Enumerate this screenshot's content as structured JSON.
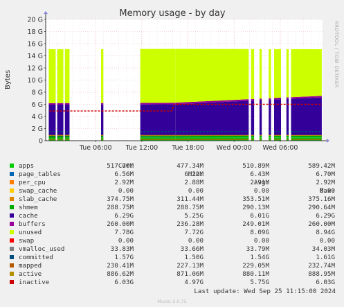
{
  "chart_data": {
    "type": "area",
    "title": "Memory usage - by day",
    "ylabel": "Bytes",
    "side_label": "RRDTOOL / TOBI OETIKER",
    "y_ticks": [
      "0",
      "2 G",
      "4 G",
      "6 G",
      "8 G",
      "10 G",
      "12 G",
      "14 G",
      "16 G",
      "18 G",
      "20 G"
    ],
    "ylim": [
      0,
      20
    ],
    "y_unit": "GiB",
    "x_ticks": [
      {
        "label": "Tue 06:00",
        "t": 6
      },
      {
        "label": "Tue 12:00",
        "t": 12
      },
      {
        "label": "Tue 18:00",
        "t": 18
      },
      {
        "label": "Wed 00:00",
        "t": 24
      },
      {
        "label": "Wed 06:00",
        "t": 30
      }
    ],
    "x_range_hours": [
      -0.5,
      35.5
    ],
    "grid": true,
    "online_intervals": [
      [
        -0.1,
        0.8
      ],
      [
        1.0,
        1.8
      ],
      [
        2.0,
        2.6
      ],
      [
        6.7,
        7.0
      ],
      [
        11.8,
        16.4
      ],
      [
        16.4,
        25.9
      ],
      [
        26.2,
        26.6
      ],
      [
        27.3,
        27.6
      ],
      [
        28.5,
        28.8
      ],
      [
        29.2,
        30.1
      ],
      [
        30.8,
        31.1
      ],
      [
        31.4,
        35.4
      ]
    ],
    "stack_levels": [
      {
        "name": "apps",
        "color": "#00cc00",
        "values": [
          0.45,
          0.5,
          0.55
        ],
        "t": [
          0,
          16,
          35
        ]
      },
      {
        "name": "page_tables",
        "color": "#0066b3",
        "values": [
          0.01,
          0.01,
          0.01
        ],
        "t": [
          0,
          16,
          35
        ]
      },
      {
        "name": "shmem",
        "color": "#00aa00",
        "values": [
          0.28,
          0.28,
          0.28
        ],
        "t": [
          0,
          16,
          35
        ]
      },
      {
        "name": "cache",
        "color": "#330099",
        "values": [
          5.2,
          5.2,
          6.3
        ],
        "t": [
          0,
          16,
          35
        ]
      },
      {
        "name": "buffers",
        "color": "#990099",
        "values": [
          0.25,
          0.25,
          0.25
        ],
        "t": [
          0,
          16,
          35
        ]
      },
      {
        "name": "unused",
        "color": "#ccff00",
        "values": [
          8.9,
          8.9,
          7.7
        ],
        "t": [
          0,
          16,
          35
        ]
      }
    ],
    "committed_level": 1.5,
    "mapped_level": 0.23,
    "active_level": 0.88,
    "inactive_values": [
      4.9,
      4.9,
      6.0,
      6.0
    ],
    "inactive_t": [
      0,
      15.9,
      16.2,
      35.4
    ]
  },
  "legend": {
    "headers": {
      "cur": "Cur:",
      "min": "Min:",
      "avg": "Avg:",
      "max": "Max:"
    },
    "rows": [
      {
        "name": "apps",
        "color": "#00cc00",
        "cur": "517.70M",
        "min": "477.34M",
        "avg": "510.89M",
        "max": "589.42M"
      },
      {
        "name": "page_tables",
        "color": "#0066b3",
        "cur": "6.56M",
        "min": "6.22M",
        "avg": "6.43M",
        "max": "6.70M"
      },
      {
        "name": "per_cpu",
        "color": "#ff8000",
        "cur": "2.92M",
        "min": "2.88M",
        "avg": "2.91M",
        "max": "2.92M"
      },
      {
        "name": "swap_cache",
        "color": "#ffcc00",
        "cur": "0.00",
        "min": "0.00",
        "avg": "0.00",
        "max": "0.00"
      },
      {
        "name": "slab_cache",
        "color": "#dd8800",
        "cur": "374.75M",
        "min": "311.44M",
        "avg": "353.51M",
        "max": "375.16M"
      },
      {
        "name": "shmem",
        "color": "#00aa00",
        "cur": "288.75M",
        "min": "288.75M",
        "avg": "290.13M",
        "max": "290.64M"
      },
      {
        "name": "cache",
        "color": "#330099",
        "cur": "6.29G",
        "min": "5.25G",
        "avg": "6.01G",
        "max": "6.29G"
      },
      {
        "name": "buffers",
        "color": "#990099",
        "cur": "260.00M",
        "min": "236.28M",
        "avg": "249.01M",
        "max": "260.00M"
      },
      {
        "name": "unused",
        "color": "#ccff00",
        "cur": "7.78G",
        "min": "7.72G",
        "avg": "8.09G",
        "max": "8.94G"
      },
      {
        "name": "swap",
        "color": "#ff0000",
        "cur": "0.00",
        "min": "0.00",
        "avg": "0.00",
        "max": "0.00"
      },
      {
        "name": "vmalloc_used",
        "color": "#808080",
        "cur": "33.83M",
        "min": "33.66M",
        "avg": "33.79M",
        "max": "34.03M"
      },
      {
        "name": "committed",
        "color": "#004d80",
        "cur": "1.57G",
        "min": "1.50G",
        "avg": "1.54G",
        "max": "1.61G"
      },
      {
        "name": "mapped",
        "color": "#b35a00",
        "cur": "230.41M",
        "min": "227.13M",
        "avg": "229.05M",
        "max": "232.74M"
      },
      {
        "name": "active",
        "color": "#b38f00",
        "cur": "886.62M",
        "min": "871.06M",
        "avg": "880.11M",
        "max": "888.95M"
      },
      {
        "name": "inactive",
        "color": "#cc0000",
        "cur": "6.03G",
        "min": "4.97G",
        "avg": "5.75G",
        "max": "6.03G"
      }
    ]
  },
  "last_update": "Last update: Wed Sep 25 11:15:00 2024",
  "footer": "Munin 2.0.75"
}
